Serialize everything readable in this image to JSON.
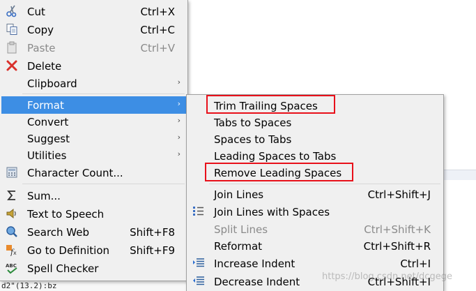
{
  "main_menu": {
    "items": [
      {
        "label": "Cut",
        "shortcut": "Ctrl+X",
        "icon": "scissors-icon"
      },
      {
        "label": "Copy",
        "shortcut": "Ctrl+C",
        "icon": "copy-icon"
      },
      {
        "label": "Paste",
        "shortcut": "Ctrl+V",
        "icon": "paste-icon",
        "disabled": true
      },
      {
        "label": "Delete",
        "shortcut": "",
        "icon": "delete-icon"
      },
      {
        "label": "Clipboard",
        "arrow": "›"
      },
      {
        "label": "Format",
        "arrow": "›",
        "highlighted": true
      },
      {
        "label": "Convert",
        "arrow": "›"
      },
      {
        "label": "Suggest",
        "arrow": "›"
      },
      {
        "label": "Utilities",
        "arrow": "›"
      },
      {
        "label": "Character Count...",
        "icon": "calculator-icon"
      },
      {
        "label": "Sum...",
        "icon": "sigma-icon"
      },
      {
        "label": "Text to Speech",
        "icon": "speaker-icon"
      },
      {
        "label": "Search Web",
        "shortcut": "Shift+F8",
        "icon": "search-web-icon"
      },
      {
        "label": "Go to Definition",
        "shortcut": "Shift+F9",
        "icon": "function-icon"
      },
      {
        "label": "Spell Checker",
        "icon": "spellcheck-icon"
      }
    ]
  },
  "format_submenu": {
    "items": [
      {
        "label": "Trim Trailing Spaces",
        "boxed": true
      },
      {
        "label": "Tabs to Spaces"
      },
      {
        "label": "Spaces to Tabs"
      },
      {
        "label": "Leading Spaces to Tabs"
      },
      {
        "label": "Remove Leading Spaces",
        "boxed": true
      },
      {
        "label": "Join Lines",
        "shortcut": "Ctrl+Shift+J"
      },
      {
        "label": "Join Lines with Spaces",
        "icon": "join-lines-icon"
      },
      {
        "label": "Split Lines",
        "shortcut": "Ctrl+Shift+K",
        "disabled": true
      },
      {
        "label": "Reformat",
        "shortcut": "Ctrl+Shift+R"
      },
      {
        "label": "Increase Indent",
        "shortcut": "Ctrl+I",
        "icon": "increase-indent-icon"
      },
      {
        "label": "Decrease Indent",
        "shortcut": "Ctrl+Shift+I",
        "icon": "decrease-indent-icon"
      }
    ]
  },
  "background": {
    "code_fragment": "d2\"(13.2):bz"
  },
  "watermark": "https://blog.csdn.net/dcgege",
  "colors": {
    "highlight": "#3d8ee4",
    "annotation": "#e8101a",
    "menu_bg": "#f0f0f0"
  }
}
